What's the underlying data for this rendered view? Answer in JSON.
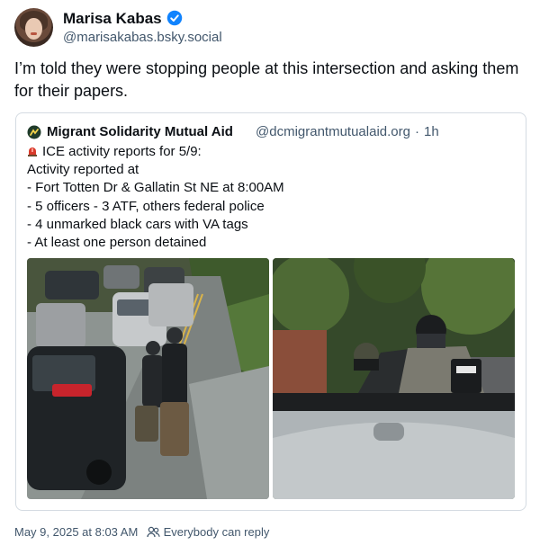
{
  "post": {
    "author": {
      "display_name": "Marisa Kabas",
      "handle": "@marisakabas.bsky.social",
      "verified_icon": "verified-badge-icon",
      "verified_color": "#1083fe"
    },
    "text": "I’m told they were stopping people at this intersection and asking them for their papers.",
    "quote": {
      "author_name": "Migrant Solidarity Mutual Aid",
      "handle": "@dcmigrantmutualaid.org",
      "separator": "·",
      "time": "1h",
      "lines": [
        "ICE activity reports for 5/9:",
        "Activity reported at",
        "- Fort Totten Dr & Gallatin St NE at 8:00AM",
        "- 5 officers - 3 ATF, others federal police",
        "- 4 unmarked black cars with VA tags",
        "- At least one person detained"
      ],
      "line_icon": "police-siren-icon"
    },
    "footer": {
      "timestamp": "May 9, 2025 at 8:03 AM",
      "reply_icon": "people-icon",
      "reply_setting": "Everybody can reply"
    }
  },
  "colors": {
    "text_primary": "#0b0f14",
    "text_secondary": "#42576c",
    "border": "#d4dbe2"
  }
}
